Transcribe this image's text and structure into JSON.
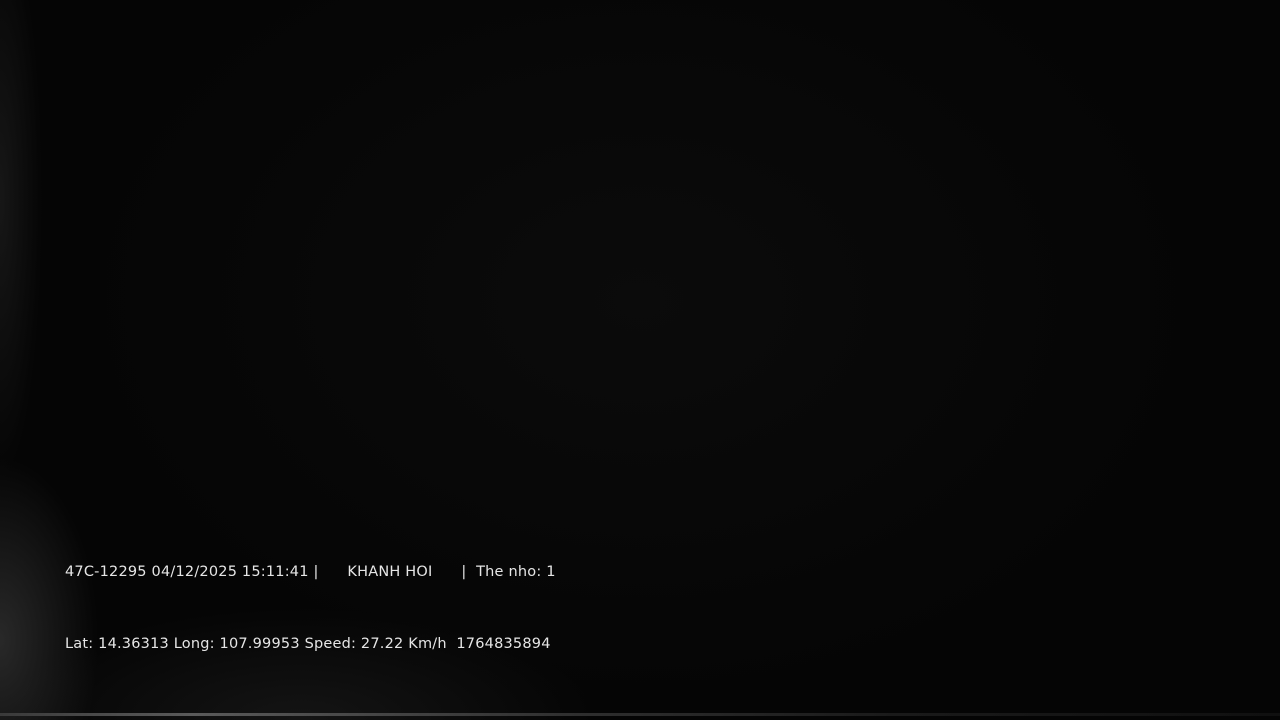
{
  "video_frame": {
    "description_free": true
  },
  "overlay": {
    "line1": {
      "plate": "47C-12295",
      "datetime": "04/12/2025 15:11:41",
      "separator1": "|",
      "location": "KHANH HOI",
      "separator2": "|",
      "card_label": "The nho: 1"
    },
    "line2": {
      "lat": "Lat: 14.36313",
      "long": "Long: 107.99953",
      "speed": "Speed: 27.22 Km/h",
      "id": "1764835894"
    }
  }
}
